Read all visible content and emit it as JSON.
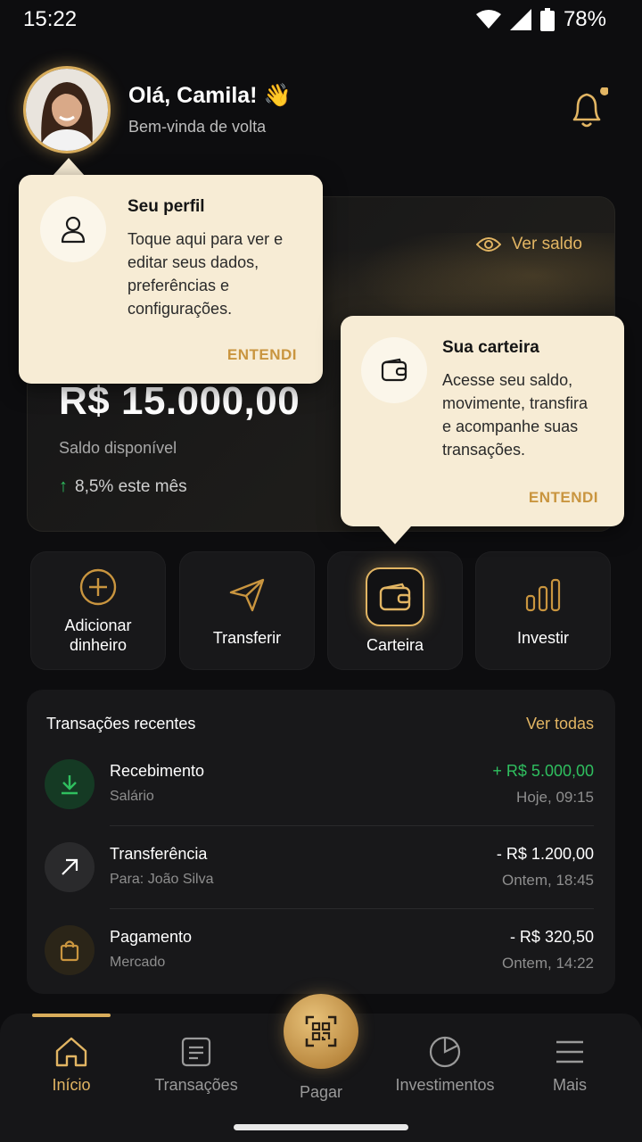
{
  "status_bar": {
    "time": "15:22",
    "battery": "78%"
  },
  "header": {
    "greeting": "Olá, Camila! 👋",
    "subtitle": "Bem-vinda de volta"
  },
  "balance": {
    "show_balance_label": "Ver saldo",
    "amount": "R$ 15.000,00",
    "label": "Saldo disponível",
    "growth": "8,5% este mês"
  },
  "actions": [
    {
      "label_line1": "Adicionar",
      "label_line2": "dinheiro",
      "icon": "plus-circle-icon"
    },
    {
      "label": "Transferir",
      "icon": "send-icon"
    },
    {
      "label": "Carteira",
      "icon": "wallet-icon"
    },
    {
      "label": "Investir",
      "icon": "bar-chart-icon"
    }
  ],
  "transactions": {
    "title": "Transações recentes",
    "see_all": "Ver todas",
    "items": [
      {
        "name": "Recebimento",
        "sub": "Salário",
        "amount": "+ R$ 5.000,00",
        "date": "Hoje, 09:15",
        "icon": "download-icon",
        "amount_color": "#2fbf5f"
      },
      {
        "name": "Transferência",
        "sub": "Para: João Silva",
        "amount": "- R$ 1.200,00",
        "date": "Ontem, 18:45",
        "icon": "arrow-up-right-icon",
        "amount_color": "#ffffff"
      },
      {
        "name": "Pagamento",
        "sub": "Mercado",
        "amount": "- R$ 320,50",
        "date": "Ontem, 14:22",
        "icon": "shopping-bag-icon",
        "amount_color": "#ffffff"
      }
    ]
  },
  "tooltips": {
    "profile": {
      "title": "Seu perfil",
      "body_lines": [
        "Toque aqui para ver e",
        "editar seus dados,",
        "preferências e",
        "configurações."
      ],
      "button": "ENTENDI"
    },
    "wallet": {
      "title": "Sua carteira",
      "body_lines": [
        "Acesse seu saldo,",
        "movimente, transfira",
        "e acompanhe suas",
        "transações."
      ],
      "button": "ENTENDI"
    }
  },
  "bottom_nav": {
    "items": [
      {
        "label": "Início",
        "icon": "home-icon",
        "active": true
      },
      {
        "label": "Transações",
        "icon": "receipt-icon",
        "active": false
      },
      {
        "label": "Pagar",
        "icon": "qr-code-icon",
        "active": false
      },
      {
        "label": "Investimentos",
        "icon": "pie-chart-icon",
        "active": false
      },
      {
        "label": "Mais",
        "icon": "menu-icon",
        "active": false
      }
    ]
  },
  "colors": {
    "accent": "#e2b563",
    "positive": "#2fbf5f",
    "tooltip_bg": "#f7ecd5",
    "background": "#0d0d0f"
  }
}
